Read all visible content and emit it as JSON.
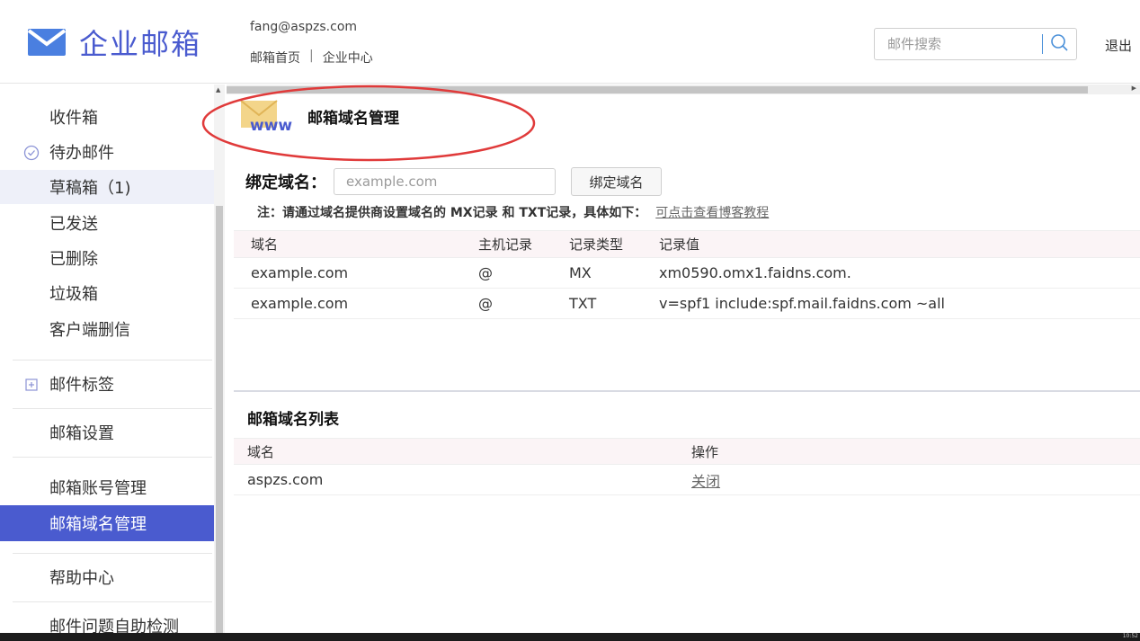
{
  "header": {
    "logo_text": "企业邮箱",
    "user_email": "fang@aspzs.com",
    "nav": [
      "邮箱首页",
      "企业中心"
    ],
    "nav_separator": "|",
    "search_placeholder": "邮件搜索",
    "logout": "退出"
  },
  "sidebar": {
    "items": [
      {
        "label": "收件箱"
      },
      {
        "label": "待办邮件",
        "icon": "check-circle-icon"
      },
      {
        "label": "草稿箱（1)"
      },
      {
        "label": "已发送"
      },
      {
        "label": "已删除"
      },
      {
        "label": "垃圾箱"
      },
      {
        "label": "客户端删信"
      },
      {
        "label": "邮件标签",
        "icon": "plus-square-icon"
      },
      {
        "label": "邮箱设置"
      },
      {
        "label": "邮箱账号管理"
      },
      {
        "label": "邮箱域名管理",
        "active": true
      },
      {
        "label": "帮助中心"
      },
      {
        "label": "邮件问题自助检测"
      }
    ]
  },
  "main": {
    "page_icon_text": "www",
    "page_title": "邮箱域名管理",
    "bind": {
      "label": "绑定域名：",
      "placeholder": "example.com",
      "button": "绑定域名"
    },
    "note": "注：请通过域名提供商设置域名的 MX记录 和 TXT记录，具体如下：",
    "note_link": "可点击查看博客教程",
    "records_table": {
      "headers": [
        "域名",
        "主机记录",
        "记录类型",
        "记录值"
      ],
      "rows": [
        [
          "example.com",
          "@",
          "MX",
          "xm0590.omx1.faidns.com."
        ],
        [
          "example.com",
          "@",
          "TXT",
          "v=spf1 include:spf.mail.faidns.com ~all"
        ]
      ]
    },
    "domain_list": {
      "title": "邮箱域名列表",
      "headers": [
        "域名",
        "操作"
      ],
      "rows": [
        {
          "domain": "aspzs.com",
          "action": "关闭"
        }
      ]
    }
  },
  "colors": {
    "accent": "#4a5bcf",
    "annotation": "#e03a3a",
    "table_header_bg": "#fbf4f6"
  },
  "taskbar": {
    "clock": "10:52"
  }
}
